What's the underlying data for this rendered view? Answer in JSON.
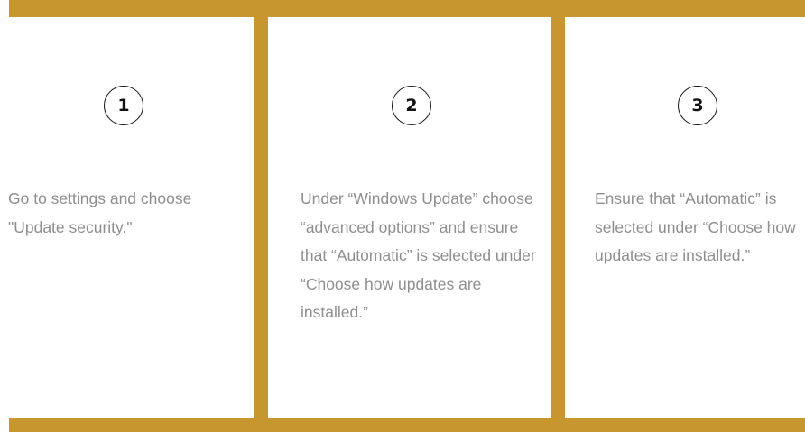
{
  "theme": {
    "accent": "#c7962e"
  },
  "steps": [
    {
      "number": "1",
      "text": "Go to settings and choose \"Update security.\""
    },
    {
      "number": "2",
      "text": "Under “Windows Update” choose “advanced options” and ensure that “Automatic” is selected under “Choose how updates are installed.”"
    },
    {
      "number": "3",
      "text": "Ensure that “Automatic” is selected under “Choose how updates are installed.”"
    }
  ]
}
